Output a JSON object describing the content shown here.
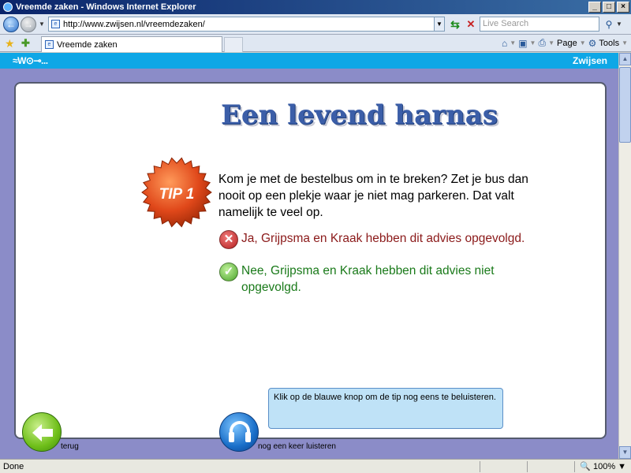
{
  "window": {
    "title": "Vreemde zaken - Windows Internet Explorer"
  },
  "address": {
    "url": "http://www.zwijsen.nl/vreemdezaken/"
  },
  "search": {
    "placeholder": "Live Search"
  },
  "tab": {
    "label": "Vreemde zaken"
  },
  "toolbar": {
    "page_label": "Page",
    "tools_label": "Tools"
  },
  "site": {
    "brand": "Zwijsen",
    "logo_text": "≈W⊙⊸..."
  },
  "content": {
    "heading": "Een levend harnas",
    "badge": "TIP 1",
    "tip": "Kom je met de bestelbus om in te breken? Zet je bus dan nooit op een plekje waar je niet mag parkeren. Dat valt namelijk te veel op.",
    "answer_wrong": "Ja, Grijpsma en Kraak hebben dit advies opgevolgd.",
    "answer_right": "Nee, Grijpsma en Kraak hebben dit advies niet opgevolgd.",
    "hint": "Klik op de blauwe knop om de tip nog eens te beluisteren.",
    "back_label": "terug",
    "listen_label": "nog een keer luisteren"
  },
  "status": {
    "text": "Done",
    "zoom": "100%"
  },
  "colors": {
    "site_header": "#0ea7e6",
    "page_bg": "#8b8cc8",
    "heading": "#3b5ea8",
    "wrong": "#8b1a1a",
    "right": "#1a7a1a",
    "hint_bg": "#bfe2f7"
  },
  "icons": [
    "ie-logo-icon",
    "back-arrow-icon",
    "forward-arrow-icon",
    "page-icon",
    "refresh-icon",
    "stop-icon",
    "search-icon",
    "favorites-star-icon",
    "add-favorites-icon",
    "home-icon",
    "feeds-icon",
    "print-icon",
    "tools-gear-icon",
    "cross-icon",
    "check-icon",
    "headphones-icon",
    "zoom-icon"
  ]
}
